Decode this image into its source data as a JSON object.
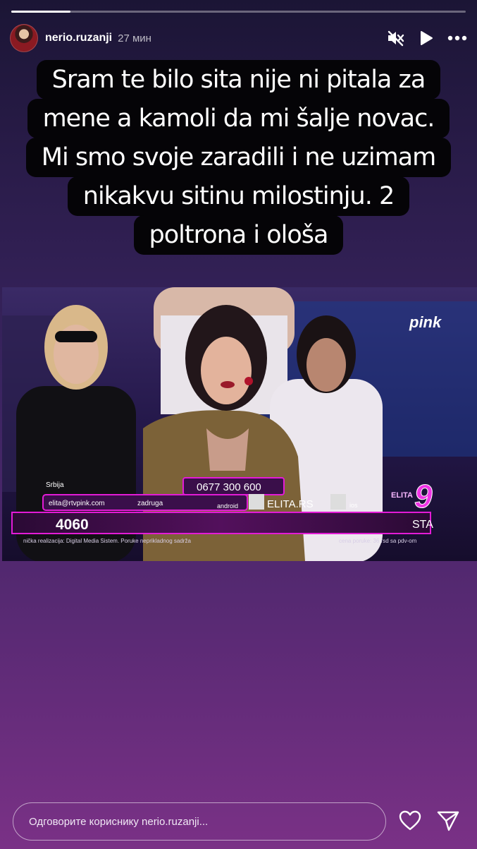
{
  "story": {
    "progress": 0.13
  },
  "header": {
    "username": "nerio.ruzanji",
    "time": "27 мин",
    "icons": {
      "avatar": "profile-avatar",
      "mute": "speaker-muted-icon",
      "play": "play-icon",
      "more": "more-dots-icon"
    }
  },
  "caption": {
    "lines": [
      "Sram te bilo sita nije ni pitala za",
      "mene a kamoli da mi šalje novac.",
      "Mi smo svoje zaradili i ne uzimam",
      "nikakvu sitinu milostinju. 2",
      "poltrona i ološa"
    ]
  },
  "tv": {
    "channel_logo": "pink",
    "show_logo": "ELITA",
    "show_number": "9",
    "region": "Srbija",
    "email": "elita@rtvpink.com",
    "social": "zadruga",
    "phone": "0677 300 600",
    "android": "android",
    "ios": "ios",
    "site": "ELITA.RS",
    "counter": "4060",
    "ticker": "STA",
    "footer_left": "nička realizacija: Digital Media Sistem. Poruke neprikladnog sadrža",
    "footer_right": "cena poruke: 36 rsd sa pdv-om"
  },
  "reply": {
    "placeholder": "Одговорите кориснику nerio.ruzanji...",
    "icons": {
      "like": "heart-icon",
      "share": "send-icon"
    }
  },
  "colors": {
    "accent": "#e31bd6",
    "background_top": "#1b1535",
    "background_bottom": "#7a3186"
  }
}
